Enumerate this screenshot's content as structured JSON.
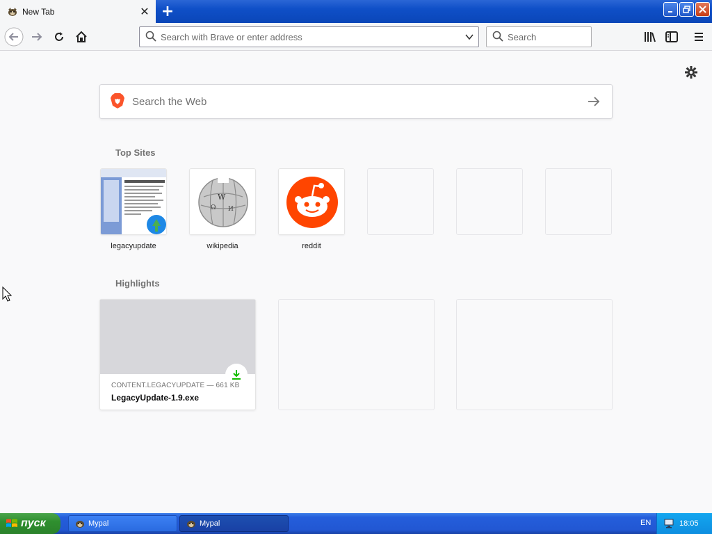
{
  "tab": {
    "title": "New Tab"
  },
  "navbar": {
    "url_placeholder": "Search with Brave or enter address",
    "search_placeholder": "Search"
  },
  "content": {
    "web_search_placeholder": "Search the Web",
    "top_sites_title": "Top Sites",
    "top_sites": [
      {
        "label": "legacyupdate"
      },
      {
        "label": "wikipedia"
      },
      {
        "label": "reddit"
      }
    ],
    "highlights_title": "Highlights",
    "highlights": [
      {
        "source": "CONTENT.LEGACYUPDATE — 661 KB",
        "filename": "LegacyUpdate-1.9.exe"
      }
    ]
  },
  "taskbar": {
    "start_label": "пуск",
    "tasks": [
      {
        "label": "Mypal"
      },
      {
        "label": "Mypal"
      }
    ],
    "language": "EN",
    "clock": "18:05"
  }
}
